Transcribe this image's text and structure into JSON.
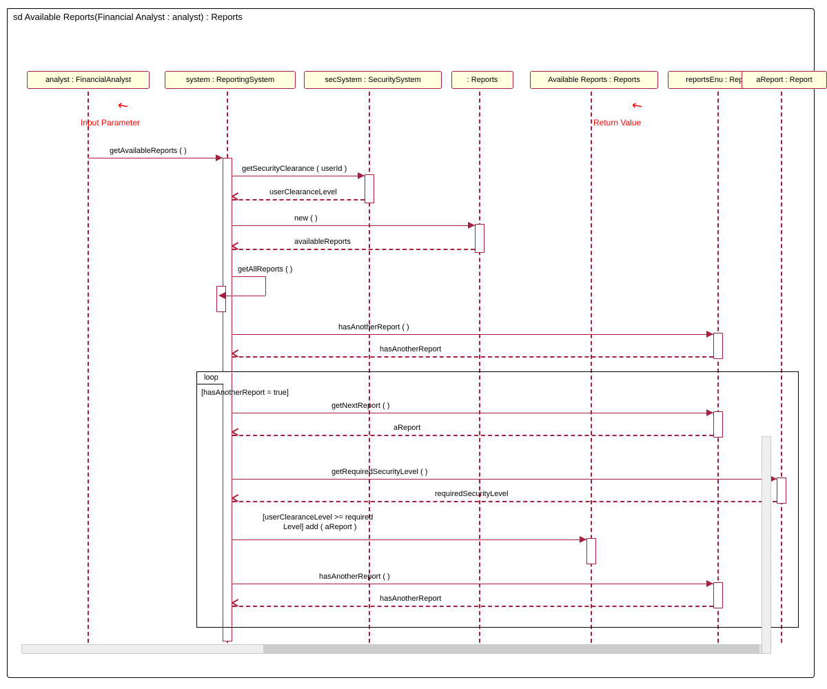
{
  "frame_title": "sd Available Reports(Financial Analyst : analyst) : Reports",
  "lifelines": {
    "analyst": "analyst : FinancialAnalyst",
    "system": "system : ReportingSystem",
    "sec": "secSystem : SecuritySystem",
    "reports": " : Reports",
    "avail": "Available Reports : Reports",
    "enu": "reportsEnu : Reports",
    "areport": "aReport : Report"
  },
  "annotations": {
    "input": "Input Parameter",
    "return": "Return Value"
  },
  "messages": {
    "m1": "getAvailableReports (  )",
    "m2": "getSecurityClearance ( userId )",
    "r2": "userClearanceLevel",
    "m3": "new (  )",
    "r3": "availableReports",
    "m4": "getAllReports (  )",
    "m5": "hasAnotherReport (  )",
    "r5": "hasAnotherReport",
    "m6": "getNextReport (  )",
    "r6": "aReport",
    "m7": "getRequiredSecurityLevel (  )",
    "r7": "requiredSecurityLevel",
    "m8a": "[userClearanceLevel >= required",
    "m8b": "Level] add ( aReport )",
    "m9": "hasAnotherReport (  )",
    "r9": "hasAnotherReport"
  },
  "loop": {
    "label": "loop",
    "guard": "[hasAnotherReport = true]"
  }
}
